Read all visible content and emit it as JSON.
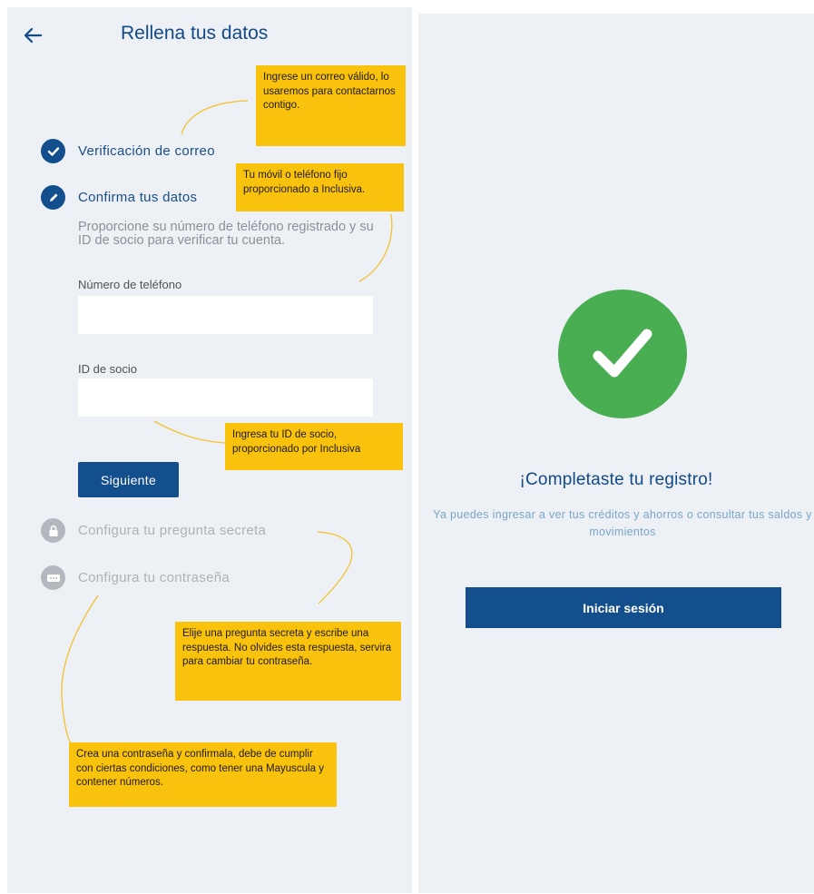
{
  "left_screen": {
    "header": {
      "title": "Rellena tus datos"
    },
    "steps": [
      {
        "label": "Verificación de correo",
        "state": "done"
      },
      {
        "label": "Confirma tus datos",
        "state": "active"
      },
      {
        "label": "Configura tu pregunta secreta",
        "state": "pending"
      },
      {
        "label": "Configura tu contraseña",
        "state": "pending"
      }
    ],
    "confirm_description": "Proporcione su número de teléfono registrado y su ID de socio para verificar tu cuenta.",
    "phone_field": {
      "label": "Número de teléfono",
      "value": "",
      "placeholder": ""
    },
    "member_id_field": {
      "label": "ID de socio",
      "value": "",
      "placeholder": ""
    },
    "next_button": "Siguiente",
    "tooltips": {
      "email": "Ingrese un correo válido, lo usaremos para contactarnos contigo.",
      "phone": "Tu móvil o teléfono fijo proporcionado a Inclusiva.",
      "member_id": "Ingresa tu ID de socio, proporcionado por Inclusiva",
      "secret_question": "Elije una pregunta secreta y escribe una respuesta. No olvides esta respuesta, servira para cambiar tu contraseña.",
      "password": "Crea una contraseña y confirmala, debe de cumplir con ciertas condiciones, como tener una Mayuscula y contener números."
    }
  },
  "right_screen": {
    "title": "¡Completaste tu registro!",
    "message": "Ya puedes ingresar a ver tus créditos y ahorros o consultar tus saldos y movimientos",
    "login_button": "Iniciar sesión"
  },
  "colors": {
    "primary": "#134e8d",
    "tooltip": "#f9c20d",
    "success": "#49ad52",
    "inactive": "#b4b8be",
    "background": "#edf0f4"
  }
}
